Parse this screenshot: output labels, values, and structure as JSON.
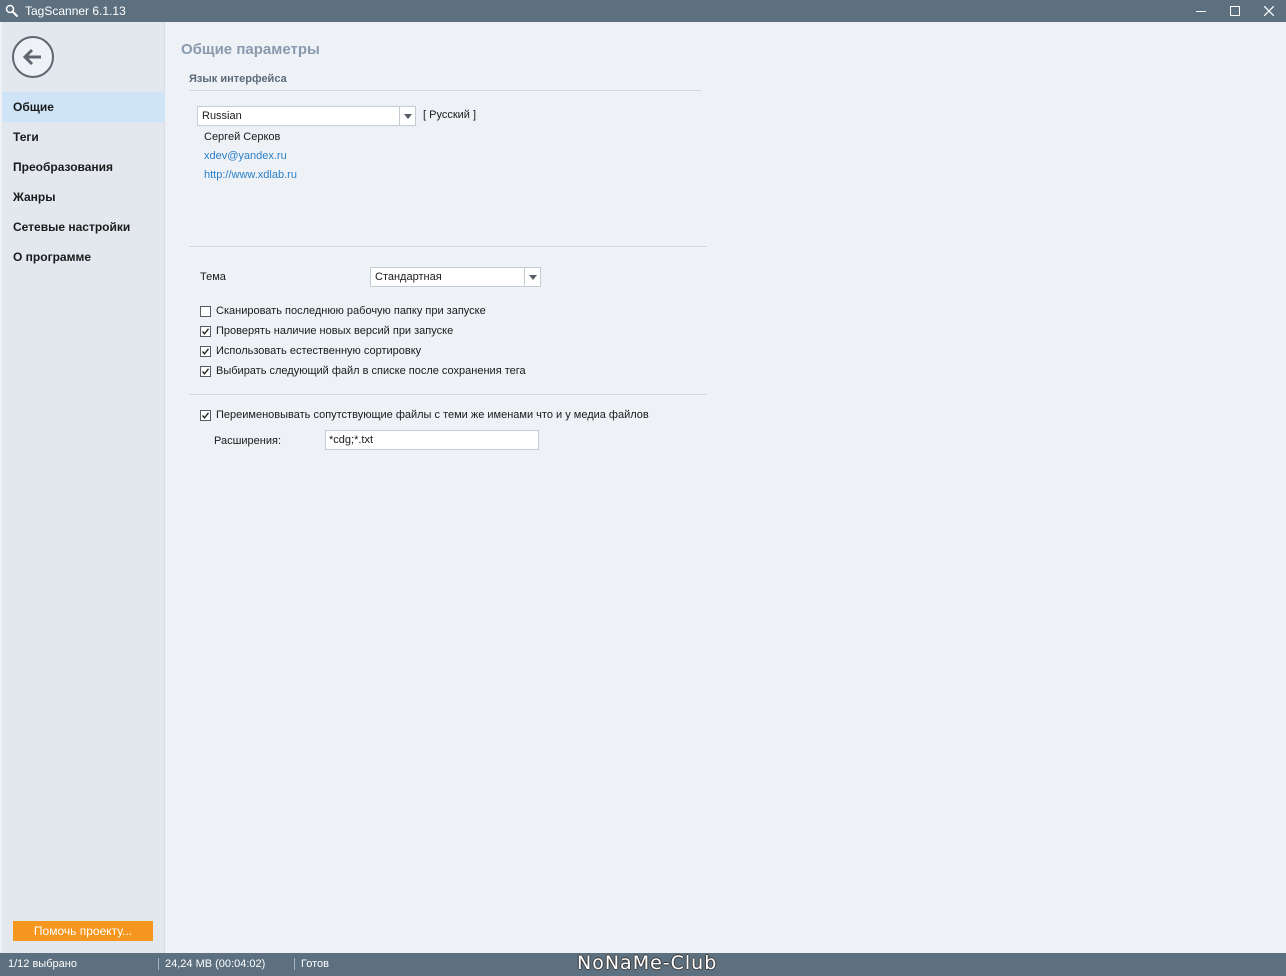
{
  "window": {
    "title": "TagScanner 6.1.13"
  },
  "sidebar": {
    "items": [
      {
        "label": "Общие",
        "active": true
      },
      {
        "label": "Теги",
        "active": false
      },
      {
        "label": "Преобразования",
        "active": false
      },
      {
        "label": "Жанры",
        "active": false
      },
      {
        "label": "Сетевые настройки",
        "active": false
      },
      {
        "label": "О программе",
        "active": false
      }
    ],
    "donate_label": "Помочь проекту..."
  },
  "main": {
    "page_title": "Общие параметры",
    "language_section": {
      "title": "Язык интерфейса",
      "language_value": "Russian",
      "language_native": "[ Русский ]",
      "translator_name": "Сергей Серков",
      "translator_email": "xdev@yandex.ru",
      "translator_site": "http://www.xdlab.ru"
    },
    "theme": {
      "label": "Тема",
      "value": "Стандартная"
    },
    "options": [
      {
        "label": "Сканировать последнюю рабочую папку при запуске",
        "checked": false
      },
      {
        "label": "Проверять наличие новых версий при запуске",
        "checked": true
      },
      {
        "label": "Использовать естественную сортировку",
        "checked": true
      },
      {
        "label": "Выбирать следующий файл в списке после сохранения тега",
        "checked": true
      }
    ],
    "rename_option": {
      "label": "Переименовывать сопутствующие файлы с теми же именами что и у медиа файлов",
      "checked": true
    },
    "extensions": {
      "label": "Расширения:",
      "value": "*cdg;*.txt"
    }
  },
  "statusbar": {
    "selection": "1/12 выбрано",
    "size": "24,24 MB (00:04:02)",
    "status": "Готов",
    "watermark": "NoNaMe-Club"
  },
  "colors": {
    "titlebar": "#5d7080",
    "sidebar_active": "#cfe4f7",
    "donate": "#f5961e",
    "link": "#2a7fc8",
    "page_title": "#8a9aae"
  }
}
